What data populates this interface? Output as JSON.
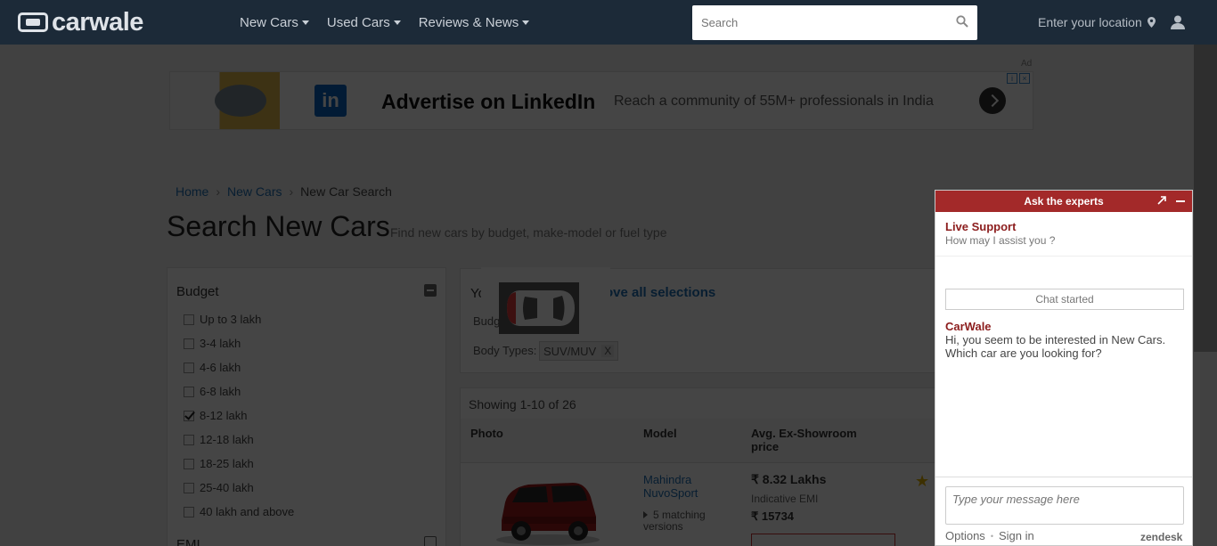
{
  "header": {
    "logo_text": "carwale",
    "nav": [
      {
        "label": "New Cars"
      },
      {
        "label": "Used Cars"
      },
      {
        "label": "Reviews & News"
      }
    ],
    "search_placeholder": "Search",
    "location_label": "Enter your location"
  },
  "ad": {
    "title": "Advertise on LinkedIn",
    "description": "Reach a community of 55M+ professionals in India",
    "logo_text": "in",
    "tag": "Ad"
  },
  "breadcrumb": {
    "items": [
      "Home",
      "New Cars"
    ],
    "current": "New Car Search"
  },
  "page": {
    "title": "Search New Cars",
    "subtitle": "Find new cars by budget, make-model or fuel type"
  },
  "filters": {
    "budget_heading": "Budget",
    "budget_options": [
      {
        "label": "Up to 3 lakh",
        "checked": false
      },
      {
        "label": "3-4 lakh",
        "checked": false
      },
      {
        "label": "4-6 lakh",
        "checked": false
      },
      {
        "label": "6-8 lakh",
        "checked": false
      },
      {
        "label": "8-12 lakh",
        "checked": true
      },
      {
        "label": "12-18 lakh",
        "checked": false
      },
      {
        "label": "18-25 lakh",
        "checked": false
      },
      {
        "label": "25-40 lakh",
        "checked": false
      },
      {
        "label": "40 lakh and above",
        "checked": false
      }
    ],
    "emi_heading": "EMI"
  },
  "selections": {
    "prefix": "Yo",
    "remove_all": "ove all selections",
    "budget_label": "Budg",
    "body_types_label": "Body Types:",
    "body_type_chip": "SUV/MUV",
    "chip_remove": "X"
  },
  "results": {
    "count_text": "Showing 1-10 of 26",
    "columns": [
      "Photo",
      "Model",
      "Avg. Ex-Showroom price"
    ],
    "rows": [
      {
        "model": "Mahindra NuvoSport",
        "matching": "5 matching versions",
        "price": "₹ 8.32 Lakhs",
        "price_note": "Indicative EMI",
        "emi": "₹ 15734"
      }
    ]
  },
  "chat": {
    "header": "Ask the experts",
    "live_support": "Live Support",
    "assist": "How may I assist you ?",
    "started": "Chat started",
    "sender": "CarWale",
    "message": "Hi, you seem to be interested in New Cars. Which car are you looking for?",
    "input_placeholder": "Type your message here",
    "options": "Options",
    "sign_in": "Sign in",
    "brand": "zendesk"
  },
  "colors": {
    "header_bg": "#1c2a38",
    "chat_accent": "#a32929",
    "link": "#1f6fb5"
  }
}
